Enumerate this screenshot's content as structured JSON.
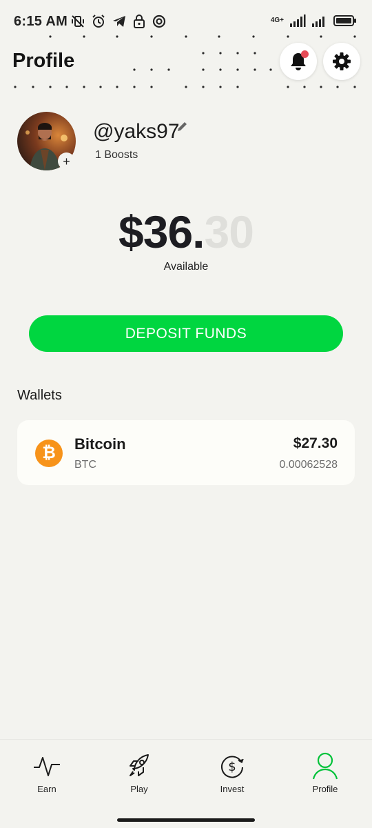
{
  "status_bar": {
    "time": "6:15 AM",
    "network": "4G+"
  },
  "header": {
    "title": "Profile",
    "notification_icon": "bell-icon",
    "settings_icon": "gear-icon",
    "notification_dot_color": "#e54a56"
  },
  "profile": {
    "username": "@yaks97",
    "boosts": "1 Boosts",
    "add_symbol": "+"
  },
  "balance": {
    "main": "$36.",
    "cents": "30",
    "label": "Available"
  },
  "deposit": {
    "label": "DEPOSIT FUNDS",
    "color": "#00d640"
  },
  "wallets": {
    "heading": "Wallets",
    "items": [
      {
        "name": "Bitcoin",
        "ticker": "BTC",
        "usd_value": "$27.30",
        "amount": "0.00062528",
        "icon": "bitcoin-icon",
        "symbol": "₿",
        "color": "#f7931a"
      }
    ]
  },
  "nav": {
    "items": [
      {
        "label": "Earn",
        "icon": "activity-icon"
      },
      {
        "label": "Play",
        "icon": "rocket-icon"
      },
      {
        "label": "Invest",
        "icon": "dollar-cycle-icon"
      },
      {
        "label": "Profile",
        "icon": "user-icon",
        "active": true
      }
    ],
    "active_color": "#00c23a"
  }
}
